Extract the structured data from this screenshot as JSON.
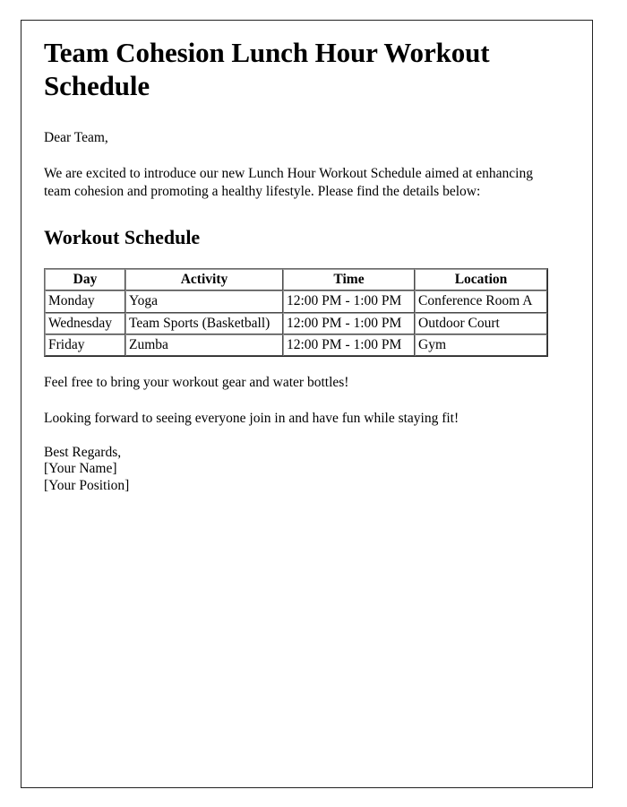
{
  "document": {
    "title": "Team Cohesion Lunch Hour Workout Schedule",
    "salutation": "Dear Team,",
    "intro_paragraph": "We are excited to introduce our new Lunch Hour Workout Schedule aimed at enhancing team cohesion and promoting a healthy lifestyle. Please find the details below:",
    "section_heading": "Workout Schedule",
    "note_gear": "Feel free to bring your workout gear and water bottles!",
    "note_closing": "Looking forward to seeing everyone join in and have fun while staying fit!",
    "signature": {
      "closing": "Best Regards,",
      "name_placeholder": "[Your Name]",
      "position_placeholder": "[Your Position]"
    }
  },
  "schedule_table": {
    "columns": [
      "Day",
      "Activity",
      "Time",
      "Location"
    ],
    "rows": [
      {
        "day": "Monday",
        "activity": "Yoga",
        "time": "12:00 PM - 1:00 PM",
        "location": "Conference Room A"
      },
      {
        "day": "Wednesday",
        "activity": "Team Sports (Basketball)",
        "time": "12:00 PM - 1:00 PM",
        "location": "Outdoor Court"
      },
      {
        "day": "Friday",
        "activity": "Zumba",
        "time": "12:00 PM - 1:00 PM",
        "location": "Gym"
      }
    ]
  },
  "colors": {
    "page_border": "#222222",
    "text": "#000000",
    "table_border": "#4a4a4a",
    "background": "#ffffff"
  }
}
